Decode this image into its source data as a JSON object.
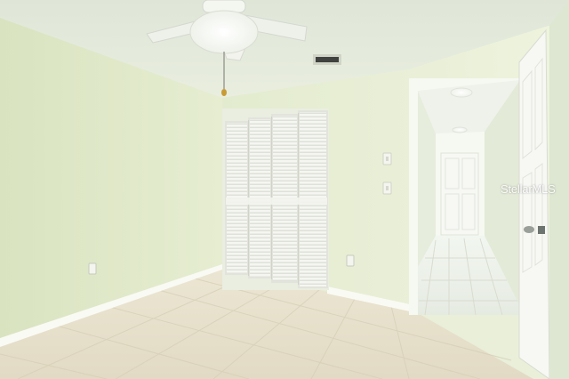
{
  "watermark": {
    "text": "StellarMLS"
  },
  "colors": {
    "ceiling": "#e4eadb",
    "wall_left": "#dfe8c8",
    "wall_back": "#e8efd4",
    "floor": "#e7e0cc",
    "door_white": "#f7f8f4",
    "baseboard": "#fbfbf6",
    "hallway": "#eef3ea"
  },
  "icons": [
    "ceiling-fan-icon",
    "air-vent-icon",
    "light-switch-icon",
    "outlet-icon"
  ]
}
